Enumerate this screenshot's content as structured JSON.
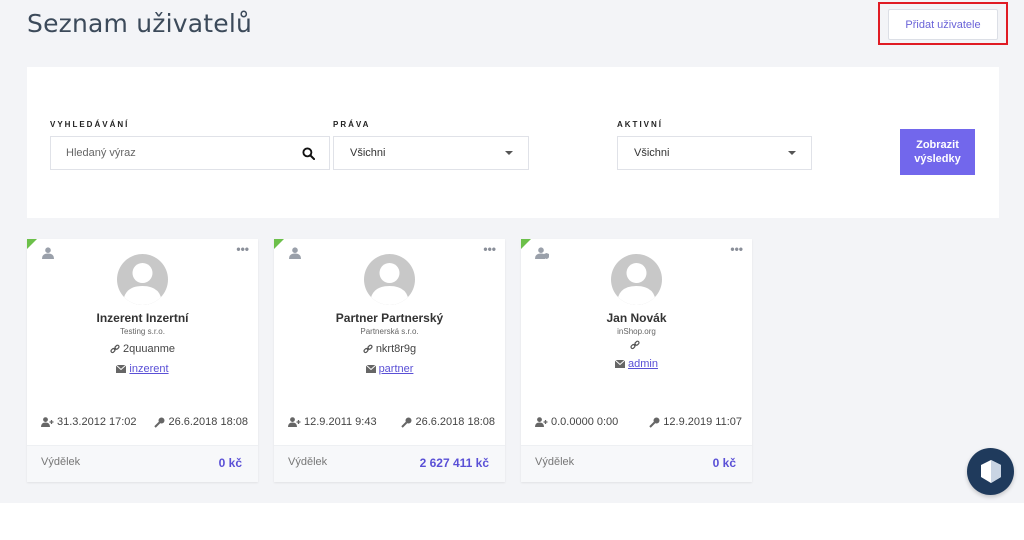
{
  "header": {
    "title": "Seznam uživatelů",
    "add_user_label": "Přidat uživatele"
  },
  "filters": {
    "search": {
      "label": "VYHLEDÁVÁNÍ",
      "placeholder": "Hledaný výraz",
      "value": ""
    },
    "rights": {
      "label": "PRÁVA",
      "value": "Všichni"
    },
    "active": {
      "label": "AKTIVNÍ",
      "value": "Všichni"
    },
    "submit_label": "Zobrazit výsledky"
  },
  "users": [
    {
      "name": "Inzerent Inzertní",
      "company": "Testing s.r.o.",
      "login": "2quuanme",
      "role": "inzerent",
      "created": "31.3.2012 17:02",
      "last_login": "26.6.2018 18:08",
      "earnings_label": "Výdělek",
      "earnings": "0 kč",
      "type_icon": "user-icon"
    },
    {
      "name": "Partner Partnerský",
      "company": "Partnerská s.r.o.",
      "login": "nkrt8r9g",
      "role": "partner",
      "created": "12.9.2011 9:43",
      "last_login": "26.6.2018 18:08",
      "earnings_label": "Výdělek",
      "earnings": "2 627 411 kč",
      "type_icon": "user-icon"
    },
    {
      "name": "Jan Novák",
      "company": "inShop.org",
      "login": "",
      "role": "admin",
      "created": "0.0.0000 0:00",
      "last_login": "12.9.2019 11:07",
      "earnings_label": "Výdělek",
      "earnings": "0 kč",
      "type_icon": "user-shield-icon"
    }
  ],
  "colors": {
    "accent": "#7267ec",
    "link": "#5a50d6",
    "active_corner": "#6cc04a",
    "highlight_border": "#e01b24",
    "chat_button": "#1f3a5c"
  }
}
